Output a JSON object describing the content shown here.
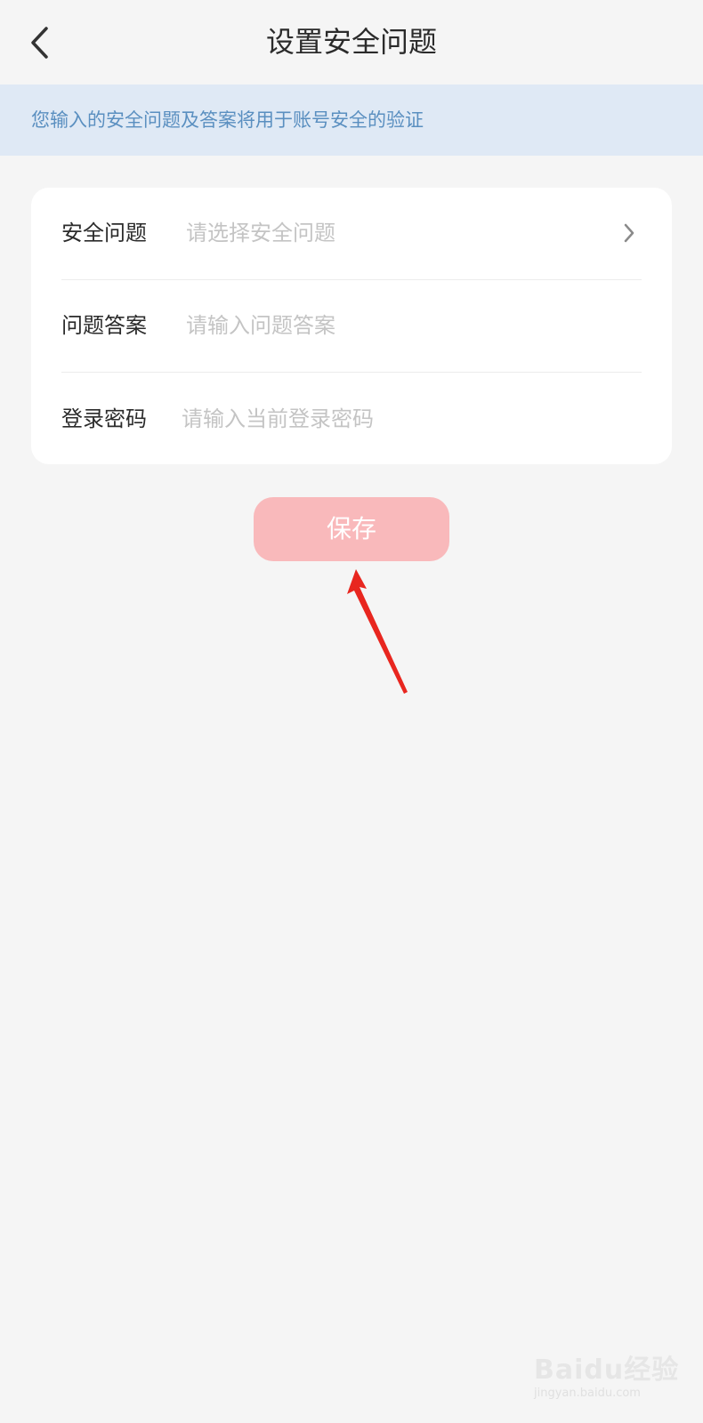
{
  "header": {
    "title": "设置安全问题",
    "back_icon": "chevron-left-icon"
  },
  "notice": {
    "text": "您输入的安全问题及答案将用于账号安全的验证",
    "color": "#5a8fc0",
    "background": "#dfe9f5"
  },
  "form": {
    "rows": [
      {
        "label": "安全问题",
        "placeholder": "请选择安全问题",
        "value": "",
        "trailing_icon": "chevron-right-icon"
      },
      {
        "label": "问题答案",
        "placeholder": "请输入问题答案",
        "value": ""
      },
      {
        "label": "登录密码",
        "placeholder": "请输入当前登录密码",
        "value": ""
      }
    ]
  },
  "save_button": {
    "label": "保存",
    "color": "#f9b9bb"
  },
  "annotation": {
    "icon": "red-arrow-icon",
    "color": "#e8261f"
  },
  "watermark": {
    "brand": "Baidu经验",
    "url": "jingyan.baidu.com"
  }
}
